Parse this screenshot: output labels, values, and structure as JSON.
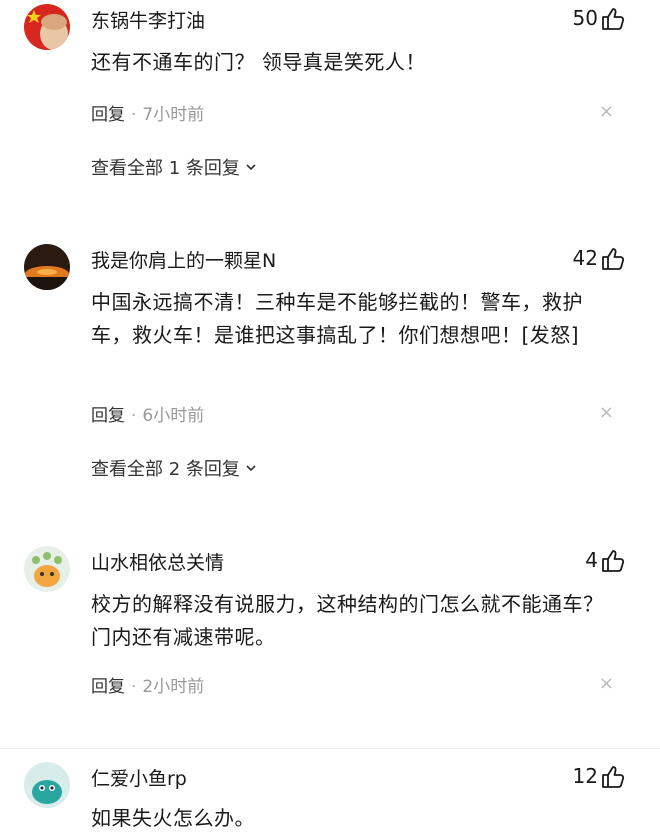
{
  "comments": [
    {
      "author": "东锅牛李打油",
      "likes": "50",
      "text": "还有不通车的门？ 领导真是笑死人！",
      "reply_label": "回复",
      "time": "7小时前",
      "view_replies": "查看全部 1 条回复"
    },
    {
      "author": "我是你肩上的一颗星N",
      "likes": "42",
      "text": "中国永远搞不清！三种车是不能够拦截的！警车，救护车，救火车！是谁把这事搞乱了！你们想想吧！[发怒]",
      "reply_label": "回复",
      "time": "6小时前",
      "view_replies": "查看全部 2 条回复"
    },
    {
      "author": "山水相依总关情",
      "likes": "4",
      "text": "校方的解释没有说服力，这种结构的门怎么就不能通车？门内还有减速带呢。",
      "reply_label": "回复",
      "time": "2小时前"
    },
    {
      "author": "仁爱小鱼rp",
      "likes": "12",
      "text": "如果失火怎么办。"
    }
  ],
  "icons": {
    "like": "thumbs-up-icon",
    "close": "close-icon",
    "expand": "chevron-down-icon"
  },
  "close_glyph": "×",
  "dot_glyph": "·"
}
